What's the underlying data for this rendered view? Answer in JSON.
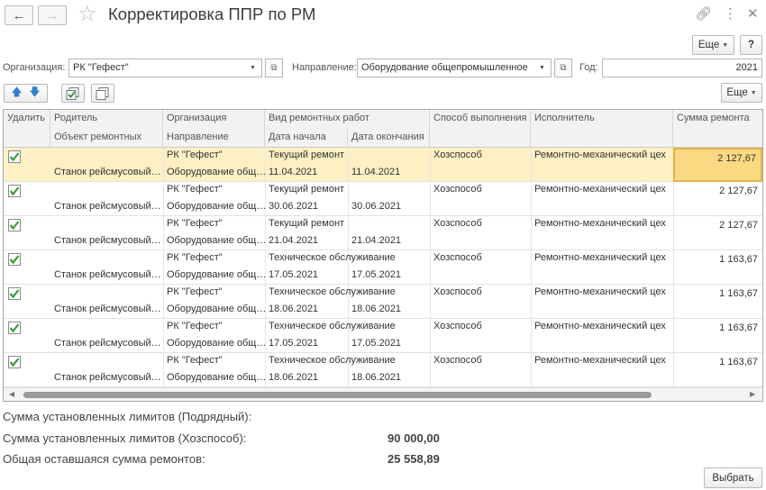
{
  "header": {
    "title": "Корректировка ППР по РМ",
    "more_label": "Еще",
    "help_label": "?"
  },
  "filters": {
    "org_label": "Организация:",
    "org_value": "РК \"Гефест\"",
    "dir_label": "Направление:",
    "dir_value": "Оборудование общепромышленное",
    "year_label": "Год:",
    "year_value": "2021"
  },
  "toolbar": {
    "more_label": "Еще"
  },
  "table": {
    "columns_top": [
      "Удалить",
      "Родитель",
      "Организация",
      "Вид ремонтных работ",
      "Способ выполнения",
      "Исполнитель",
      "Сумма ремонта"
    ],
    "columns_bottom": [
      "Объект ремонтных",
      "Направление",
      "Дата начала",
      "Дата окончания"
    ],
    "rows": [
      {
        "checked": true,
        "parent": "",
        "object": "Станок рейсмусовый…",
        "org": "РК \"Гефест\"",
        "direction": "Оборудование общ…",
        "work": "Текущий ремонт",
        "start": "11.04.2021",
        "end": "11.04.2021",
        "method": "Хозспособ",
        "executor": "Ремонтно-механический цех",
        "sum": "2 127,67",
        "selected": true
      },
      {
        "checked": true,
        "parent": "",
        "object": "Станок рейсмусовый…",
        "org": "РК \"Гефест\"",
        "direction": "Оборудование общ…",
        "work": "Текущий ремонт",
        "start": "30.06.2021",
        "end": "30.06.2021",
        "method": "Хозспособ",
        "executor": "Ремонтно-механический цех",
        "sum": "2 127,67",
        "selected": false
      },
      {
        "checked": true,
        "parent": "",
        "object": "Станок рейсмусовый…",
        "org": "РК \"Гефест\"",
        "direction": "Оборудование общ…",
        "work": "Текущий ремонт",
        "start": "21.04.2021",
        "end": "21.04.2021",
        "method": "Хозспособ",
        "executor": "Ремонтно-механический цех",
        "sum": "2 127,67",
        "selected": false
      },
      {
        "checked": true,
        "parent": "",
        "object": "Станок рейсмусовый…",
        "org": "РК \"Гефест\"",
        "direction": "Оборудование общ…",
        "work": "Техническое обслуживание",
        "start": "17.05.2021",
        "end": "17.05.2021",
        "method": "Хозспособ",
        "executor": "Ремонтно-механический цех",
        "sum": "1 163,67",
        "selected": false
      },
      {
        "checked": true,
        "parent": "",
        "object": "Станок рейсмусовый…",
        "org": "РК \"Гефест\"",
        "direction": "Оборудование общ…",
        "work": "Техническое обслуживание",
        "start": "18.06.2021",
        "end": "18.06.2021",
        "method": "Хозспособ",
        "executor": "Ремонтно-механический цех",
        "sum": "1 163,67",
        "selected": false
      },
      {
        "checked": true,
        "parent": "",
        "object": "Станок рейсмусовый…",
        "org": "РК \"Гефест\"",
        "direction": "Оборудование общ…",
        "work": "Техническое обслуживание",
        "start": "17.05.2021",
        "end": "17.05.2021",
        "method": "Хозспособ",
        "executor": "Ремонтно-механический цех",
        "sum": "1 163,67",
        "selected": false
      },
      {
        "checked": true,
        "parent": "",
        "object": "Станок рейсмусовый…",
        "org": "РК \"Гефест\"",
        "direction": "Оборудование общ…",
        "work": "Техническое обслуживание",
        "start": "18.06.2021",
        "end": "18.06.2021",
        "method": "Хозспособ",
        "executor": "Ремонтно-механический цех",
        "sum": "1 163,67",
        "selected": false
      }
    ]
  },
  "footer": {
    "contract_label": "Сумма установленных лимитов (Подрядный):",
    "contract_value": "",
    "own_label": "Сумма установленных лимитов (Хозспособ):",
    "own_value": "90 000,00",
    "remaining_label": "Общая оставшаяся сумма ремонтов:",
    "remaining_value": "25 558,89",
    "select_label": "Выбрать"
  },
  "colors": {
    "selected_row": "#fcf0c4",
    "selected_cell": "#f9d981",
    "checkbox_green": "#3a9a3a",
    "arrow_blue": "#2f7fd0"
  }
}
